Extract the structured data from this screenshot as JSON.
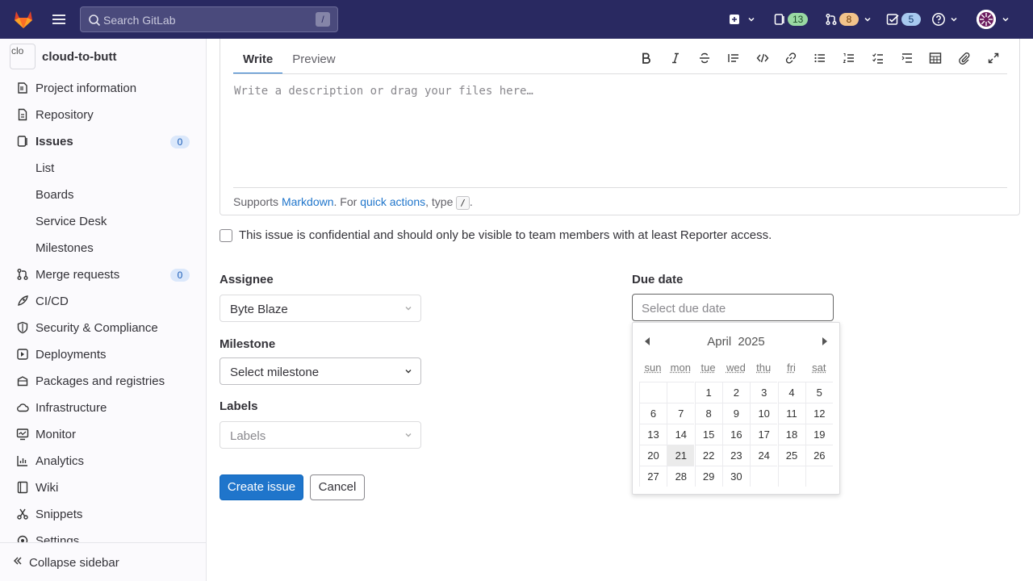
{
  "topbar": {
    "search_placeholder": "Search GitLab",
    "search_shortcut": "/",
    "issues_count": "13",
    "merge_requests_count": "8",
    "todos_count": "5",
    "colors": {
      "bg": "#292961"
    }
  },
  "sidebar": {
    "project_image_alt": "clo",
    "project_name": "cloud-to-butt",
    "items": [
      {
        "label": "Project information",
        "icon": "project-icon"
      },
      {
        "label": "Repository",
        "icon": "doc-icon"
      },
      {
        "label": "Issues",
        "icon": "issues-icon",
        "count": "0"
      },
      {
        "label": "List"
      },
      {
        "label": "Boards"
      },
      {
        "label": "Service Desk"
      },
      {
        "label": "Milestones"
      },
      {
        "label": "Merge requests",
        "icon": "merge-request-icon",
        "count": "0"
      },
      {
        "label": "CI/CD",
        "icon": "rocket-icon"
      },
      {
        "label": "Security & Compliance",
        "icon": "shield-icon"
      },
      {
        "label": "Deployments",
        "icon": "deployments-icon"
      },
      {
        "label": "Packages and registries",
        "icon": "package-icon"
      },
      {
        "label": "Infrastructure",
        "icon": "cloud-icon"
      },
      {
        "label": "Monitor",
        "icon": "monitor-icon"
      },
      {
        "label": "Analytics",
        "icon": "chart-icon"
      },
      {
        "label": "Wiki",
        "icon": "book-icon"
      },
      {
        "label": "Snippets",
        "icon": "snippet-icon"
      },
      {
        "label": "Settings",
        "icon": "settings-icon"
      }
    ],
    "collapse_label": "Collapse sidebar"
  },
  "editor": {
    "tabs": [
      "Write",
      "Preview"
    ],
    "placeholder": "Write a description or drag your files here…",
    "footer_supports": "Supports ",
    "footer_markdown": "Markdown",
    "footer_for": ". For ",
    "footer_quick_actions": "quick actions",
    "footer_type": ", type ",
    "footer_kbd": "/",
    "footer_end": "."
  },
  "confidential_label": "This issue is confidential and should only be visible to team members with at least Reporter access.",
  "fields": {
    "assignee_label": "Assignee",
    "assignee_value": "Byte Blaze",
    "milestone_label": "Milestone",
    "milestone_value": "Select milestone",
    "labels_label": "Labels",
    "labels_value": "Labels",
    "due_date_label": "Due date",
    "due_date_placeholder": "Select due date"
  },
  "buttons": {
    "create": "Create issue",
    "cancel": "Cancel"
  },
  "calendar": {
    "month": "April",
    "year": "2025",
    "weekdays": [
      "sun",
      "mon",
      "tue",
      "wed",
      "thu",
      "fri",
      "sat"
    ],
    "weeks": [
      [
        "",
        "",
        "1",
        "2",
        "3",
        "4",
        "5"
      ],
      [
        "6",
        "7",
        "8",
        "9",
        "10",
        "11",
        "12"
      ],
      [
        "13",
        "14",
        "15",
        "16",
        "17",
        "18",
        "19"
      ],
      [
        "20",
        "21",
        "22",
        "23",
        "24",
        "25",
        "26"
      ],
      [
        "27",
        "28",
        "29",
        "30",
        "",
        "",
        ""
      ]
    ],
    "today": "21"
  }
}
